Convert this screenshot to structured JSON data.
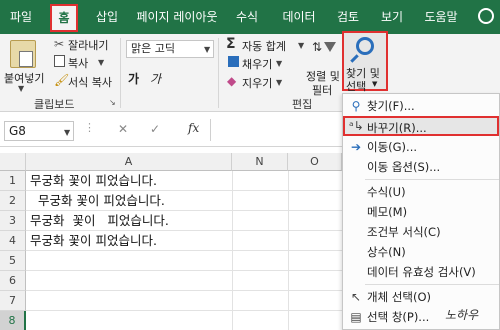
{
  "tabs": [
    "파일",
    "홈",
    "삽입",
    "페이지 레이아웃",
    "수식",
    "데이터",
    "검토",
    "보기",
    "도움말"
  ],
  "clipboard": {
    "paste": "붙여넣기",
    "cut": "잘라내기",
    "copy": "복사",
    "format_painter": "서식 복사",
    "group_label": "클립보드"
  },
  "font": {
    "name": "맑은 고딕"
  },
  "editing": {
    "autosum": "자동 합계",
    "fill": "채우기",
    "clear": "지우기",
    "sort_filter_line1": "정렬 및",
    "sort_filter_line2": "필터",
    "find_select_line1": "찾기 및",
    "find_select_line2": "선택",
    "group_label": "편집"
  },
  "formula_bar": {
    "name_box": "G8",
    "cancel": "✕",
    "enter": "✓",
    "fx": "fx"
  },
  "columns": [
    "A",
    "N",
    "O"
  ],
  "rows": [
    {
      "num": "1",
      "text": "무궁화 꽃이 피었습니다."
    },
    {
      "num": "2",
      "text": "  무궁화 꽃이 피었습니다."
    },
    {
      "num": "3",
      "text": "무궁화  꽃이   피었습니다."
    },
    {
      "num": "4",
      "text": "무궁화 꽃이 피었습니다."
    },
    {
      "num": "5",
      "text": ""
    },
    {
      "num": "6",
      "text": ""
    },
    {
      "num": "7",
      "text": ""
    },
    {
      "num": "8",
      "text": ""
    }
  ],
  "menu": {
    "find": "찾기(F)...",
    "replace": "바꾸기(R)...",
    "goto": "이동(G)...",
    "goto_special": "이동 옵션(S)...",
    "formulas": "수식(U)",
    "notes": "메모(M)",
    "conditional_formatting": "조건부 서식(C)",
    "constants": "상수(N)",
    "data_validation": "데이터 유효성 검사(V)",
    "select_objects": "개체 선택(O)",
    "selection_pane": "선택 창(P)..."
  },
  "watermark": "노하우",
  "colors": {
    "excel_green": "#217346",
    "highlight_red": "#e03030"
  }
}
